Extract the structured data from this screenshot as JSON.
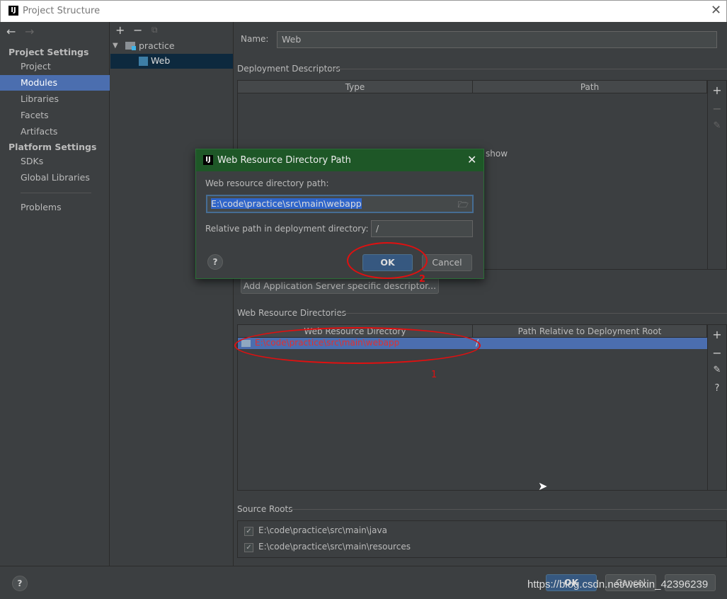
{
  "window": {
    "title": "Project Structure",
    "logo": "IJ"
  },
  "sidebar": {
    "project_settings": "Project Settings",
    "items": [
      {
        "label": "Project"
      },
      {
        "label": "Modules",
        "selected": true
      },
      {
        "label": "Libraries"
      },
      {
        "label": "Facets"
      },
      {
        "label": "Artifacts"
      }
    ],
    "platform_settings": "Platform Settings",
    "platform_items": [
      {
        "label": "SDKs"
      },
      {
        "label": "Global Libraries"
      }
    ],
    "problems": "Problems"
  },
  "tree": {
    "root": "practice",
    "child": "Web"
  },
  "main": {
    "name_label": "Name:",
    "name_value": "Web",
    "deployment_descriptors": {
      "title": "Deployment Descriptors",
      "columns": [
        "Type",
        "Path"
      ],
      "partial_text": "show",
      "add_button": "Add Application Server specific descriptor..."
    },
    "web_resource_dirs": {
      "title": "Web Resource Directories",
      "columns": [
        "Web Resource Directory",
        "Path Relative to Deployment Root"
      ],
      "rows": [
        {
          "directory": "E:\\code\\practice\\src\\main\\webapp",
          "relative": "/"
        }
      ]
    },
    "source_roots": {
      "title": "Source Roots",
      "items": [
        {
          "path": "E:\\code\\practice\\src\\main\\java",
          "checked": true
        },
        {
          "path": "E:\\code\\practice\\src\\main\\resources",
          "checked": true
        }
      ]
    }
  },
  "dialog": {
    "title": "Web Resource Directory Path",
    "path_label": "Web resource directory path:",
    "path_value": "E:\\code\\practice\\src\\main\\webapp",
    "relative_label": "Relative path in deployment directory:",
    "relative_value": "/",
    "ok": "OK",
    "cancel": "Cancel",
    "help": "?"
  },
  "annotations": {
    "one": "1",
    "two": "2"
  },
  "footer": {
    "ok": "OK",
    "cancel": "Cancel",
    "help": "?",
    "watermark": "https://blog.csdn.net/weixin_42396239"
  },
  "colors": {
    "selection": "#4b6eaf",
    "dialog_title": "#1e5727",
    "annotation": "#e01010"
  }
}
